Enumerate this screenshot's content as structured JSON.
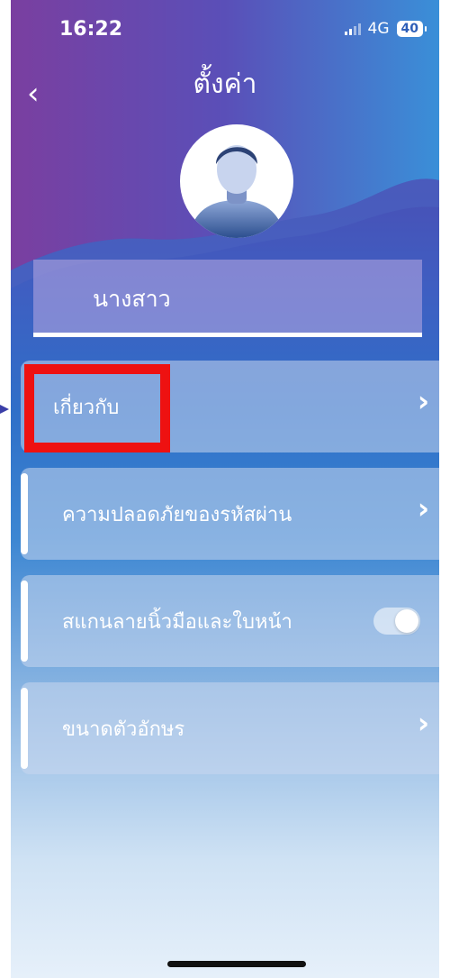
{
  "status_bar": {
    "time": "16:22",
    "network": "4G",
    "battery": "40"
  },
  "header": {
    "title": "ตั้งค่า",
    "back_icon": "chevron-left-icon"
  },
  "profile": {
    "name": "นางสาว",
    "avatar_icon": "user-avatar-icon"
  },
  "menu": {
    "items": [
      {
        "label": "เกี่ยวกับ",
        "trailing": "chevron-right-icon"
      },
      {
        "label": "ความปลอดภัยของรหัสผ่าน",
        "trailing": "chevron-right-icon"
      },
      {
        "label": "สแกนลายนิ้วมือและใบหน้า",
        "trailing": "toggle",
        "toggle_on": true
      },
      {
        "label": "ขนาดตัวอักษร",
        "trailing": "chevron-right-icon"
      }
    ]
  },
  "annotation": {
    "highlight_color": "#ee1111",
    "arrow_color": "#3b3fa8"
  },
  "colors": {
    "gradient_top": "#5d3fa3",
    "gradient_mid": "#2f6fc8",
    "gradient_bottom": "#e6f0fa"
  }
}
